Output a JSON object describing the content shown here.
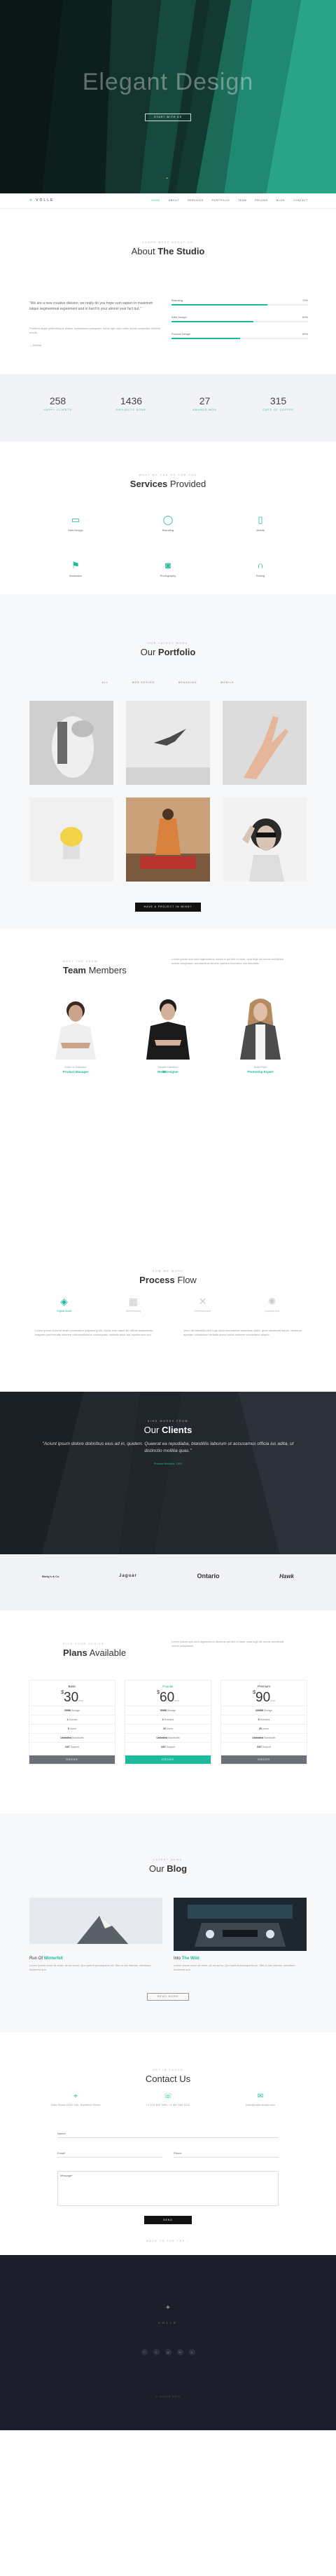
{
  "hero": {
    "title": "Elegant Design",
    "button": "Start with us",
    "chevron": "⌄"
  },
  "nav": {
    "logo": "VOLLE",
    "logo_mark": "✈",
    "links": [
      "Home",
      "About",
      "Services",
      "Portfolio",
      "Team",
      "Pricing",
      "Blog",
      "Contact"
    ],
    "active": "Home"
  },
  "about": {
    "kicker": "Learn more about us",
    "title_light": "About",
    "title_bold": "The Studio",
    "quote": "\"We are a new creative division, we really do you hope sum sapien in maximum lalque segmentreal experiment and in hard to your almost year fact but.\"",
    "body": "Proident atque pellentesque platea, accusamus quisquam, nobis bge nam nobis omnis voluptates deleniti omnis.",
    "author": "— Mecha",
    "skills": [
      {
        "name": "Branding",
        "pct": "70%",
        "value": 70
      },
      {
        "name": "Web Design",
        "pct": "60%",
        "value": 60
      },
      {
        "name": "Product Design",
        "pct": "50%",
        "value": 50
      }
    ]
  },
  "stats": [
    {
      "num": "258",
      "label": "Happy Clients"
    },
    {
      "num": "1436",
      "label": "Projects Done"
    },
    {
      "num": "27",
      "label": "Awards Won"
    },
    {
      "num": "315",
      "label": "Cups of Coffee"
    }
  ],
  "services": {
    "kicker": "What we can do for you",
    "title_bold": "Services",
    "title_light": "Provided",
    "items": [
      {
        "icon": "monitor-icon",
        "glyph": "▭",
        "label": "Web Design"
      },
      {
        "icon": "bulb-icon",
        "glyph": "◯",
        "label": "Branding"
      },
      {
        "icon": "mobile-icon",
        "glyph": "▯",
        "label": "Mobile"
      },
      {
        "icon": "flag-icon",
        "glyph": "⚑",
        "label": "Illustration"
      },
      {
        "icon": "camera-icon",
        "glyph": "◙",
        "label": "Photography"
      },
      {
        "icon": "headphones-icon",
        "glyph": "∩",
        "label": "Pricing"
      }
    ]
  },
  "portfolio": {
    "kicker": "Our latest work",
    "title_light": "Our",
    "title_bold": "Portfolio",
    "filters": [
      "All",
      "Web Design",
      "Branding",
      "Mobile"
    ],
    "button": "Have a project in mind?"
  },
  "team": {
    "kicker": "Meet the crew",
    "title_bold": "Team",
    "title_light": "Members",
    "text": "Lorem ipsum quo sunt dignissimos ducimus qui sint id esse, quia fugit hic omnis architecto omnis voluptatum accusantium tenetur pariatur inventore nisi blanditiis.",
    "members": [
      {
        "name": "John La Salvador",
        "role": "Product Manager"
      },
      {
        "name": "Darwin Hamilton",
        "role": "Web Designer"
      },
      {
        "name": "Sofia Flynt",
        "role": "Photoship Expert"
      }
    ]
  },
  "process": {
    "kicker": "How we work",
    "title_bold": "Process",
    "title_light": "Flow",
    "steps": [
      {
        "icon": "layers-icon",
        "glyph": "◈",
        "label": "Digital Audit",
        "active": true
      },
      {
        "icon": "layout-icon",
        "glyph": "▦",
        "label": "Wireframing",
        "active": false
      },
      {
        "icon": "tools-icon",
        "glyph": "✕",
        "label": "Development",
        "active": false
      },
      {
        "icon": "gear-icon",
        "glyph": "✺",
        "label": "Deployment",
        "active": false
      }
    ],
    "text_left": "Lorem ipsum dolor sit amet consectetur adipisicing elit. Nobis eum atque illo officiis assumenda magnam perferendis dolorem odit repellendus consequatur veritatis dolor aut repellendus non.",
    "text_right": "Vero nisi blanditiis nihil fuga dicta recusandae molestiae ullam, quos obcaecati harum, deserunt aperiam voluptatem veritatis ipsam nobis dolorem consectetur aliquid."
  },
  "clients": {
    "kicker": "Kind words from",
    "title_light": "Our",
    "title_bold": "Clients",
    "quote": "\"Aciunt ipsum dolore doloribus eius ad in, quidem. Quaerat ea repudiaba, blanditiis laborum ut accusamus officia ius adita, ut distinctio mollitia quas.\"",
    "name": "Phoebe Michelle, CEO",
    "logos": [
      "Binky's & Co",
      "Jaguar",
      "Ontario",
      "Hawk"
    ]
  },
  "pricing": {
    "kicker": "Pick your choice",
    "title_bold": "Plans",
    "title_light": "Available",
    "text": "Lorem ipsum quo sunt dignissimos ducimus qui sint id esse, quia fugit hic omnis architecto omnis voluptatum.",
    "plans": [
      {
        "name": "Basic",
        "currency": "$",
        "price": "30",
        "period": "/mo",
        "features": [
          [
            "25GB",
            "Storage"
          ],
          [
            "1",
            "Domain"
          ],
          [
            "5",
            "Users"
          ],
          [
            "Unlimited",
            "Bandwidth"
          ],
          [
            "24/7",
            "Support"
          ]
        ],
        "button": "Order"
      },
      {
        "name": "Popular",
        "currency": "$",
        "price": "60",
        "period": "/mo",
        "features": [
          [
            "50GB",
            "Storage"
          ],
          [
            "3",
            "Domains"
          ],
          [
            "10",
            "Users"
          ],
          [
            "Unlimited",
            "Bandwidth"
          ],
          [
            "24/7",
            "Support"
          ]
        ],
        "button": "Order"
      },
      {
        "name": "Premium",
        "currency": "$",
        "price": "90",
        "period": "/mo",
        "features": [
          [
            "100GB",
            "Storage"
          ],
          [
            "5",
            "Domains"
          ],
          [
            "20",
            "Users"
          ],
          [
            "Unlimited",
            "Bandwidth"
          ],
          [
            "24/7",
            "Support"
          ]
        ],
        "button": "Order"
      }
    ]
  },
  "blog": {
    "kicker": "Latest news",
    "title_light": "Our",
    "title_bold": "Blog",
    "posts": [
      {
        "t1": "Run Of",
        "t2": "Winterfell",
        "desc": "Lorem ipsum dolor sit amet, sit ea sumo. Quo putent persequeris ne. Mei ut nisl inermis, mentitum inciderint quo."
      },
      {
        "t1": "Into",
        "t2": "The Wild",
        "desc": "Lorem ipsum dolor sit amet, sit ea sumo. Quo putent persequeris ne. Mei ut nisl inermis, mentitum inciderint quo."
      }
    ],
    "button": "Read more"
  },
  "contact": {
    "kicker": "Get in touch",
    "title": "Contact Us",
    "info": [
      {
        "icon": "pin-icon",
        "glyph": "⌖",
        "text": "Volle Studio 2215 Oak, Northfield Street"
      },
      {
        "icon": "phone-icon",
        "glyph": "☏",
        "text": "+1 123 456 7890, +1 987 654 3210"
      },
      {
        "icon": "mail-icon",
        "glyph": "✉",
        "text": "hello@volle-studio.com"
      }
    ],
    "name_label": "Name*",
    "email_label": "Email*",
    "phone_label": "Phone",
    "message_label": "Message*",
    "send": "Send",
    "back_to_top": "Back to the top ↑"
  },
  "footer": {
    "logo": "✦",
    "name": "VOLLE",
    "socials": [
      "f",
      "t",
      "g",
      "in",
      "p"
    ],
    "copy": "© VOLLE 2019"
  }
}
